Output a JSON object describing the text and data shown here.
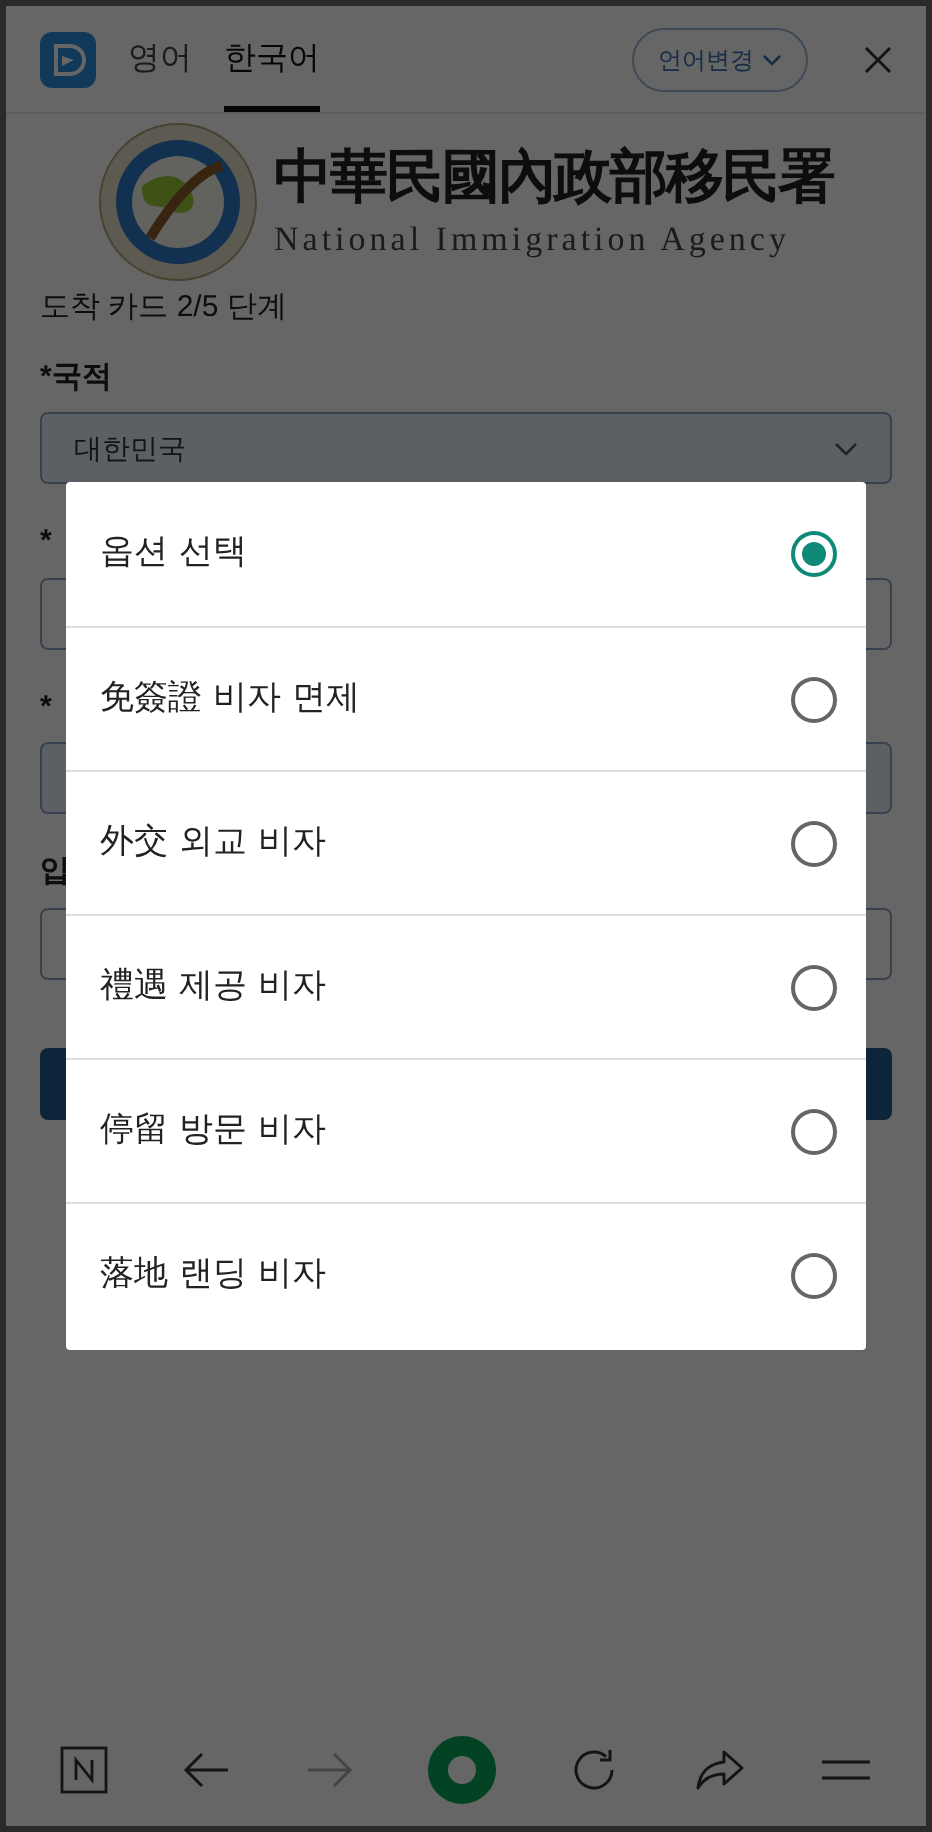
{
  "header": {
    "tabs": [
      {
        "label": "영어",
        "selected": false
      },
      {
        "label": "한국어",
        "selected": true
      }
    ],
    "language_button": "언어변경"
  },
  "logo": {
    "title_zh": "中華民國內政部移民署",
    "title_en": "National Immigration Agency"
  },
  "step": "도착 카드 2/5 단계",
  "fields": [
    {
      "label": "*국적",
      "kind": "select",
      "value": "대한민국"
    },
    {
      "label": "*",
      "kind": "input"
    },
    {
      "label": "*",
      "kind": "select"
    },
    {
      "label": "입",
      "kind": "input"
    }
  ],
  "dialog": {
    "options": [
      {
        "label": "옵션 선택",
        "selected": true
      },
      {
        "label": "免簽證 비자 면제",
        "selected": false
      },
      {
        "label": "外交 외교 비자",
        "selected": false
      },
      {
        "label": "禮遇 제공 비자",
        "selected": false
      },
      {
        "label": "停留 방문 비자",
        "selected": false
      },
      {
        "label": "落地 랜딩 비자",
        "selected": false
      }
    ]
  }
}
